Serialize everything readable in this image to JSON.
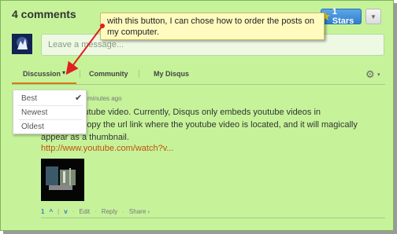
{
  "header": {
    "comment_count": "4 comments",
    "stars_label": "1 Stars",
    "star_icon": "star-icon",
    "dropdown_icon": "chevron-down-icon"
  },
  "composer": {
    "placeholder": "Leave a message...",
    "avatar_icon": "user-avatar"
  },
  "tabs": {
    "discussion": "Discussion",
    "community": "Community",
    "my_disqus": "My Disqus",
    "discussion_caret": "▾",
    "gear_icon": "gear-icon",
    "gear_caret": "▾"
  },
  "sort_menu": {
    "options": [
      "Best",
      "Newest",
      "Oldest"
    ],
    "selected": "Best",
    "check": "✔"
  },
  "comment": {
    "time": "minutes ago",
    "text_line1": "st a youtube video. Currently, Disqus only embeds youtube videos in",
    "text_line2": "ust copy the url link where the youtube video is located, and it will magically",
    "text_line3": "appear as a thumbnail.",
    "link": "http://www.youtube.com/watch?v...",
    "votes": "1",
    "up_icon": "^",
    "down_icon": "v",
    "edit": "Edit",
    "reply": "Reply",
    "share": "Share ›"
  },
  "annotation": {
    "text": "with this button, I can chose how to order the posts on my computer."
  },
  "colors": {
    "background": "#c6f39a",
    "active_tab_underline": "#d97b1d",
    "link": "#c44f0d",
    "callout_bg": "#fffbbe",
    "arrow": "#e02020",
    "stars_button": "#3a8bd6"
  }
}
